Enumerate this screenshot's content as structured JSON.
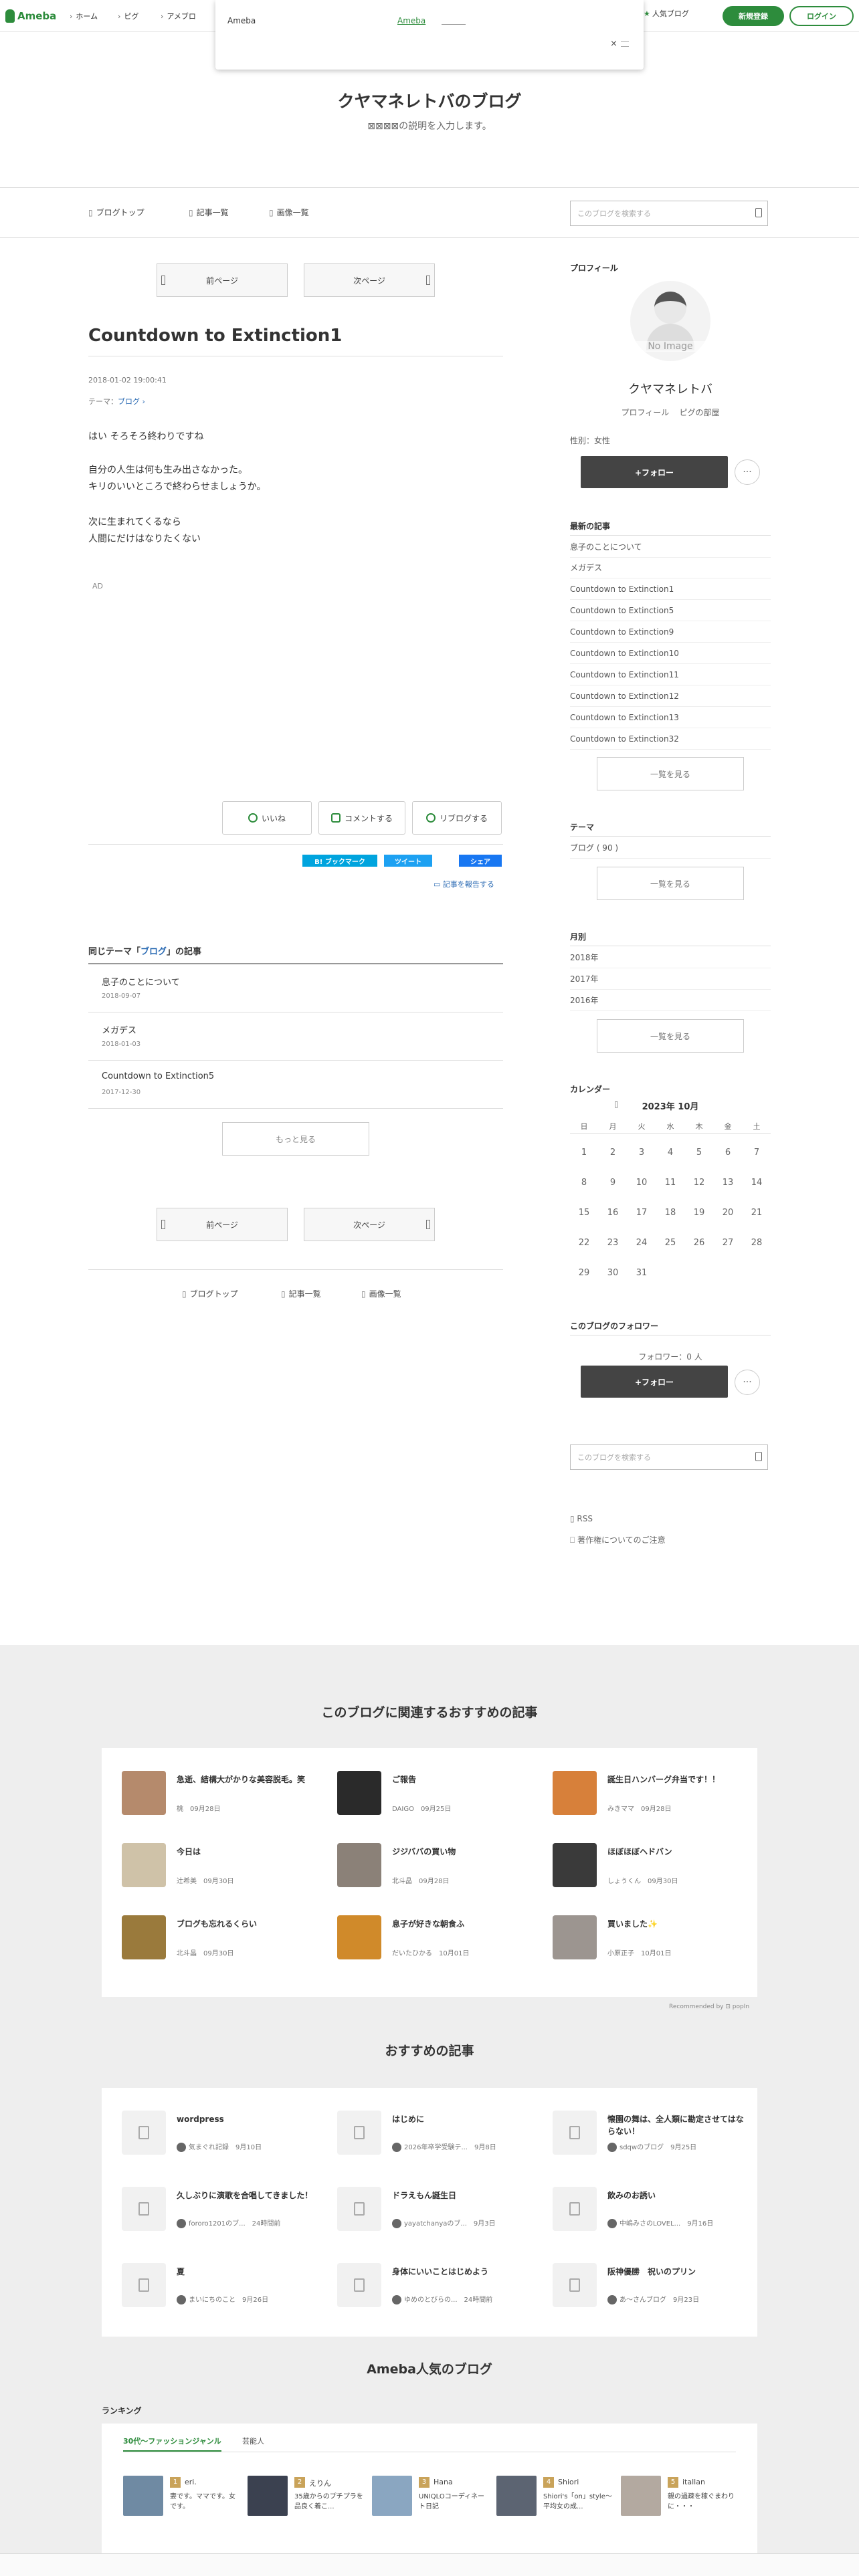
{
  "topbar": {
    "logo": "Ameba",
    "nav": [
      "ホーム",
      "ピグ",
      "アメブロ"
    ],
    "popular": "人気ブログ",
    "register": "新規登録",
    "login": "ログイン"
  },
  "popup": {
    "title": "Ameba",
    "link": "Ameba",
    "close": "×"
  },
  "blog": {
    "title": "クヤマネレトバのブログ",
    "description": "⊠⊠⊠⊠の説明を入力します。"
  },
  "nav": {
    "top": "ブログトップ",
    "list": "記事一覧",
    "images": "画像一覧",
    "search_placeholder": "このブログを検索する"
  },
  "pager": {
    "prev": "前ページ",
    "next": "次ページ"
  },
  "entry": {
    "title": "Countdown to Extinction1",
    "date": "2018-01-02 19:00:41",
    "theme_label": "テーマ：",
    "theme": "ブログ",
    "paragraphs": [
      [
        "はい そろそろ終わりですね"
      ],
      [
        "自分の人生は何も生み出さなかった。",
        "キリのいいところで終わらせましょうか。"
      ],
      [
        "次に生まれてくるなら",
        "人間にだけはなりたくない"
      ]
    ],
    "ad": "AD"
  },
  "actions": {
    "like": "いいね",
    "comment": "コメントする",
    "reblog": "リブログする"
  },
  "share": {
    "hatena": "B! ブックマーク",
    "tweet": "ツイート",
    "facebook": "シェア",
    "report": "記事を報告する"
  },
  "related": {
    "head_prefix": "同じテーマ「",
    "theme": "ブログ",
    "head_suffix": "」の記事",
    "items": [
      {
        "title": "息子のことについて",
        "date": "2018-09-07"
      },
      {
        "title": "メガデス",
        "date": "2018-01-03"
      },
      {
        "title": "Countdown to Extinction5",
        "date": "2017-12-30"
      }
    ],
    "more": "もっと見る"
  },
  "sidebar": {
    "profile_head": "プロフィール",
    "avatar_text": "No Image",
    "name": "クヤマネレトバ",
    "profile_link": "プロフィール",
    "pig_link": "ピグの部屋",
    "gender": "性別：女性",
    "follow": "+フォロー",
    "more": "···",
    "recent_head": "最新の記事",
    "recent": [
      "息子のことについて",
      "メガデス",
      "Countdown to Extinction1",
      "Countdown to Extinction5",
      "Countdown to Extinction9",
      "Countdown to Extinction10",
      "Countdown to Extinction11",
      "Countdown to Extinction12",
      "Countdown to Extinction13",
      "Countdown to Extinction32"
    ],
    "view_all": "一覧を見る",
    "theme_head": "テーマ",
    "themes": [
      "ブログ ( 90 )"
    ],
    "monthly_head": "月別",
    "months": [
      "2018年",
      "2017年",
      "2016年"
    ],
    "calendar_head": "カレンダー",
    "calendar_title": "2023年 10月",
    "weekdays": [
      "日",
      "月",
      "火",
      "水",
      "木",
      "金",
      "土"
    ],
    "weeks": [
      [
        "1",
        "2",
        "3",
        "4",
        "5",
        "6",
        "7"
      ],
      [
        "8",
        "9",
        "10",
        "11",
        "12",
        "13",
        "14"
      ],
      [
        "15",
        "16",
        "17",
        "18",
        "19",
        "20",
        "21"
      ],
      [
        "22",
        "23",
        "24",
        "25",
        "26",
        "27",
        "28"
      ],
      [
        "29",
        "30",
        "31",
        "",
        "",
        "",
        ""
      ]
    ],
    "followers_head": "このブログのフォロワー",
    "followers": "フォロワー：0 人",
    "rss": "RSS",
    "copyright": "著作権についてのご注意"
  },
  "recommend": {
    "head": "このブログに関連するおすすめの記事",
    "items": [
      {
        "title": "急逝、結構大がかりな美容脱毛。笑",
        "author": "桃",
        "date": "09月28日",
        "color": "#b58a6c"
      },
      {
        "title": "ご報告",
        "author": "DAIGO",
        "date": "09月25日",
        "color": "#2a2a2a"
      },
      {
        "title": "誕生日ハンバーグ弁当です！！",
        "author": "みきママ",
        "date": "09月28日",
        "color": "#d7803a"
      },
      {
        "title": "今日は",
        "author": "辻希美",
        "date": "09月30日",
        "color": "#cfc2a8"
      },
      {
        "title": "ジジババの買い物",
        "author": "北斗晶",
        "date": "09月28日",
        "color": "#8b8178"
      },
      {
        "title": "ほぼほぼヘドバン",
        "author": "しょうくん",
        "date": "09月30日",
        "color": "#3a3a3a"
      },
      {
        "title": "ブログも忘れるくらい",
        "author": "北斗晶",
        "date": "09月30日",
        "color": "#9a7a3c"
      },
      {
        "title": "息子が好きな朝食ふ",
        "author": "だいたひかる",
        "date": "10月01日",
        "color": "#d08a2a"
      },
      {
        "title": "買いました✨",
        "author": "小原正子",
        "date": "10月01日",
        "color": "#9c9590"
      }
    ],
    "recommended_by": "Recommended by ⊡ popIn"
  },
  "osusume": {
    "head": "おすすめの記事",
    "items": [
      {
        "title": "wordpress",
        "author": "気まぐれ記録",
        "date": "9月10日"
      },
      {
        "title": "はじめに",
        "author": "2026年卒学受験テ...",
        "date": "9月8日"
      },
      {
        "title": "懐園の舞は、全人類に勘定させてはならない！",
        "author": "sdqwのブログ",
        "date": "9月25日"
      },
      {
        "title": "久しぶりに演歌を合唱してきました！",
        "author": "fororo1201のブ...",
        "date": "24時間前"
      },
      {
        "title": "ドラえもん誕生日",
        "author": "yayatchanyaのブ...",
        "date": "9月3日"
      },
      {
        "title": "飲みのお誘い",
        "author": "中嶋みさのLOVEL...",
        "date": "9月16日"
      },
      {
        "title": "夏",
        "author": "まいにちのこと",
        "date": "9月26日"
      },
      {
        "title": "身体にいいことはじめよう",
        "author": "ゆめのとびらの...",
        "date": "24時間前"
      },
      {
        "title": "阪神優勝　祝いのプリン",
        "author": "あ〜さんブログ",
        "date": "9月23日"
      }
    ]
  },
  "popular": {
    "head": "Ameba人気のブログ",
    "ranking_label": "ランキング",
    "tabs": [
      "30代〜ファッションジャンル",
      "芸能人"
    ],
    "items": [
      {
        "rank": "1",
        "name": "eri.",
        "desc": "妻です。ママです。女です。"
      },
      {
        "rank": "2",
        "name": "えりん",
        "desc": "35歳からのプチプラを品良く着こ..."
      },
      {
        "rank": "3",
        "name": "Hana",
        "desc": "UNIQLOコーディネート日記"
      },
      {
        "rank": "4",
        "name": "Shiori",
        "desc": "Shiori's「on」style〜平均女の成..."
      },
      {
        "rank": "5",
        "name": "itallan",
        "desc": "親の過疎を稼ぐまわりに・・・"
      }
    ]
  }
}
